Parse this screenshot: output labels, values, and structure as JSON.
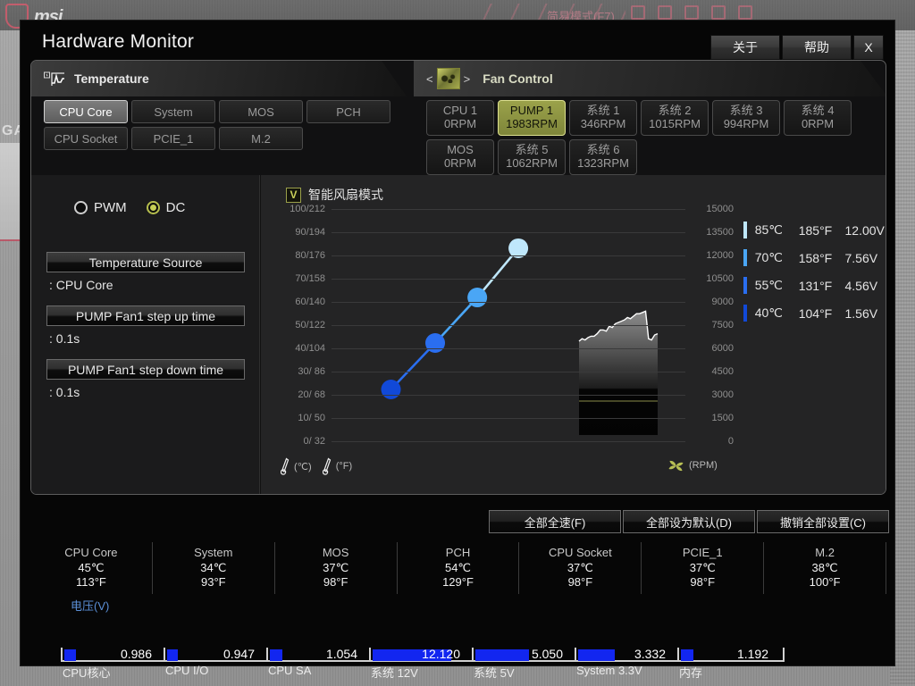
{
  "background": {
    "brand": "msi",
    "ez_mode_label": "简易模式(F7)",
    "side_label": "GA"
  },
  "window": {
    "title": "Hardware Monitor",
    "buttons": [
      {
        "name": "about",
        "label": "关于"
      },
      {
        "name": "help",
        "label": "帮助"
      },
      {
        "name": "close",
        "label": "X"
      }
    ]
  },
  "panels": {
    "temperature": {
      "header": "Temperature",
      "icon": "temperature-graph-icon",
      "tabs_row1": [
        "CPU Core",
        "System",
        "MOS",
        "PCH"
      ],
      "tabs_row2": [
        "CPU Socket",
        "PCIE_1",
        "M.2"
      ],
      "active_tab": "CPU Core"
    },
    "fan_control": {
      "header": "Fan Control",
      "icon": "fan-icon",
      "prev_arrow": "<",
      "next_arrow": ">",
      "fans_row1": [
        {
          "name": "CPU 1",
          "rpm": "0RPM",
          "active": false
        },
        {
          "name": "PUMP 1",
          "rpm": "1983RPM",
          "active": true
        },
        {
          "name": "系统 1",
          "rpm": "346RPM",
          "active": false
        },
        {
          "name": "系统 2",
          "rpm": "1015RPM",
          "active": false
        },
        {
          "name": "系统 3",
          "rpm": "994RPM",
          "active": false
        },
        {
          "name": "系统 4",
          "rpm": "0RPM",
          "active": false
        }
      ],
      "fans_row2": [
        {
          "name": "MOS",
          "rpm": "0RPM",
          "active": false
        },
        {
          "name": "系统 5",
          "rpm": "1062RPM",
          "active": false
        },
        {
          "name": "系统 6",
          "rpm": "1323RPM",
          "active": false
        }
      ]
    }
  },
  "controls": {
    "mode_pwm": "PWM",
    "mode_dc": "DC",
    "selected_mode": "DC",
    "temperature_source_label": "Temperature Source",
    "temperature_source_value": ": CPU Core",
    "step_up_label": "PUMP Fan1 step up time",
    "step_up_value": ": 0.1s",
    "step_down_label": "PUMP Fan1 step down time",
    "step_down_value": ": 0.1s",
    "smart_fan_mode_label": "智能风扇模式",
    "smart_fan_mode_checked": true,
    "checkbox_glyph": "V"
  },
  "chart_data": {
    "type": "line",
    "title": "智能风扇模式",
    "xlabel": "(°C) / (°F)",
    "ylabel": "(RPM)",
    "y_left_ticks": [
      "100/212",
      "90/194",
      "80/176",
      "70/158",
      "60/140",
      "50/122",
      "40/104",
      "30/ 86",
      "20/ 68",
      "10/ 50",
      "0/ 32"
    ],
    "y_right_ticks": [
      "15000",
      "13500",
      "12000",
      "10500",
      "9000",
      "7500",
      "6000",
      "4500",
      "3000",
      "1500",
      "0"
    ],
    "ylim_left": [
      0,
      100
    ],
    "ylim_right": [
      0,
      15000
    ],
    "grid": true,
    "series": [
      {
        "name": "PUMP 1 fan curve",
        "points": [
          {
            "temp_c": 40,
            "temp_f": 104,
            "volts": "1.56V",
            "color": "#1149d8",
            "x_pct": 16.8,
            "y_pct": 77.7
          },
          {
            "temp_c": 55,
            "temp_f": 131,
            "volts": "4.56V",
            "color": "#2a6ef0",
            "x_pct": 29.3,
            "y_pct": 57.7
          },
          {
            "temp_c": 70,
            "temp_f": 158,
            "volts": "7.56V",
            "color": "#4aa6f5",
            "x_pct": 41.2,
            "y_pct": 38.1
          },
          {
            "temp_c": 85,
            "temp_f": 185,
            "volts": "12.00V",
            "color": "#bfe7fb",
            "x_pct": 52.8,
            "y_pct": 16.9
          }
        ]
      }
    ],
    "history_overlay": {
      "name": "fan-rpm-history",
      "present": true,
      "trace_color": "#ffffff"
    }
  },
  "legend": [
    {
      "temp_c": "85℃",
      "temp_f": "185°F",
      "volts": "12.00V",
      "color": "#bfe7fb"
    },
    {
      "temp_c": "70℃",
      "temp_f": "158°F",
      "volts": "7.56V",
      "color": "#4aa6f5"
    },
    {
      "temp_c": "55℃",
      "temp_f": "131°F",
      "volts": "4.56V",
      "color": "#2a6ef0"
    },
    {
      "temp_c": "40℃",
      "temp_f": "104°F",
      "volts": "1.56V",
      "color": "#1149d8"
    }
  ],
  "units": {
    "celsius": "(℃)",
    "fahrenheit": "(°F)",
    "rpm": "(RPM)"
  },
  "actions": [
    {
      "name": "all-full-speed",
      "label": "全部全速(F)"
    },
    {
      "name": "all-default",
      "label": "全部设为默认(D)"
    },
    {
      "name": "revert-all",
      "label": "撤销全部设置(C)"
    }
  ],
  "temperatures": [
    {
      "name": "CPU Core",
      "c": "45℃",
      "f": "113°F"
    },
    {
      "name": "System",
      "c": "34℃",
      "f": "93°F"
    },
    {
      "name": "MOS",
      "c": "37℃",
      "f": "98°F"
    },
    {
      "name": "PCH",
      "c": "54℃",
      "f": "129°F"
    },
    {
      "name": "CPU Socket",
      "c": "37℃",
      "f": "98°F"
    },
    {
      "name": "PCIE_1",
      "c": "37℃",
      "f": "98°F"
    },
    {
      "name": "M.2",
      "c": "38℃",
      "f": "100°F"
    }
  ],
  "voltage": {
    "title": "电压(V)",
    "items": [
      {
        "name": "CPU核心",
        "value": "0.986",
        "fill_pct": 14
      },
      {
        "name": "CPU I/O",
        "value": "0.947",
        "fill_pct": 13
      },
      {
        "name": "CPU SA",
        "value": "1.054",
        "fill_pct": 15
      },
      {
        "name": "系统 12V",
        "value": "12.120",
        "fill_pct": 92
      },
      {
        "name": "系统 5V",
        "value": "5.050",
        "fill_pct": 62
      },
      {
        "name": "System 3.3V",
        "value": "3.332",
        "fill_pct": 43
      },
      {
        "name": "内存",
        "value": "1.192",
        "fill_pct": 15
      }
    ]
  },
  "colors": {
    "accent_olive": "#9ba24a",
    "voltage_bar": "#1226f0",
    "volt_title": "#5b8fd6",
    "window_bg": "#060606"
  }
}
